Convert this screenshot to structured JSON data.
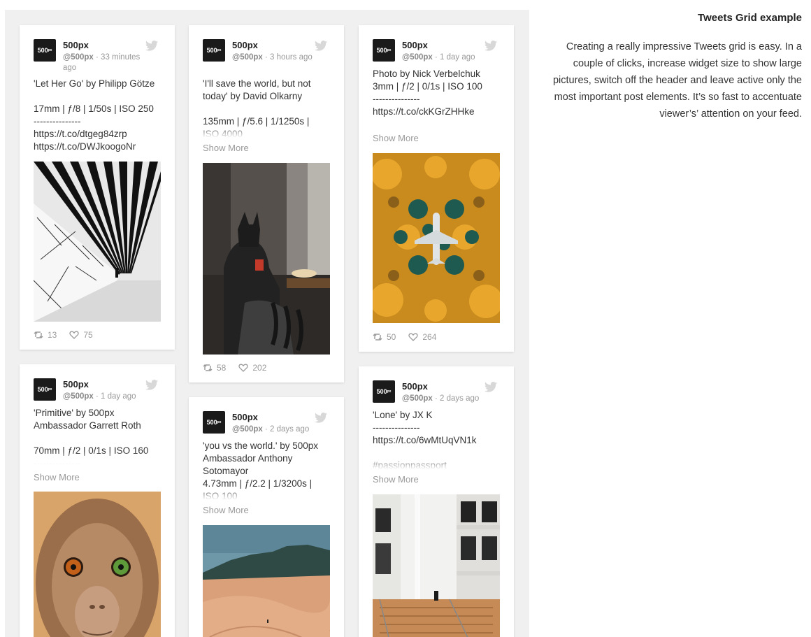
{
  "sidebar": {
    "title": "Tweets Grid example",
    "description": "Creating a really impressive Tweets grid is easy. In a couple of clicks, increase widget size to show large pictures, switch off the header and leave active only the most important post elements. It’s so fast to accentuate viewer’s’ attention on your feed."
  },
  "show_more_label": "Show More",
  "cards": [
    {
      "author": "500px",
      "handle": "@500px",
      "time": " · 33 minutes ago",
      "text": "'Let Her Go' by Philipp Götze\n\n17mm | ƒ/8 | 1/50s | ISO 250\n---------------\nhttps://t.co/dtgeg84zrp\nhttps://t.co/DWJkoogoNr",
      "retweets": "13",
      "likes": "75",
      "image": "corridor-photo"
    },
    {
      "author": "500px",
      "handle": "@500px",
      "time": " · 3 hours ago",
      "text": "'I'll save the world, but not today' by David Olkarny\n\n135mm | ƒ/5.6 | 1/1250s |\nISO 4000",
      "retweets": "58",
      "likes": "202",
      "image": "batman-photo"
    },
    {
      "author": "500px",
      "handle": "@500px",
      "time": " · 1 day ago",
      "text": "Photo by Nick Verbelchuk\n3mm | ƒ/2 | 0/1s | ISO 100\n---------------\nhttps://t.co/ckKGrZHHke",
      "retweets": "50",
      "likes": "264",
      "image": "forest-plane-photo"
    },
    {
      "author": "500px",
      "handle": "@500px",
      "time": " · 1 day ago",
      "text": "'Primitive' by 500px\nAmbassador Garrett Roth\n\n70mm | ƒ/2 | 0/1s | ISO 160\n---------------",
      "image": "monkey-photo"
    },
    {
      "author": "500px",
      "handle": "@500px",
      "time": " · 2 days ago",
      "text": "'you vs the world.' by 500px Ambassador Anthony Sotomayor\n4.73mm | ƒ/2.2 | 1/3200s |\nISO 100",
      "image": "desert-photo"
    },
    {
      "author": "500px",
      "handle": "@500px",
      "time": " · 2 days ago",
      "text": "'Lone' by JX K\n---------------\nhttps://t.co/6wMtUqVN1k\n\n#passionpassport",
      "image": "building-photo"
    }
  ],
  "colors": {
    "panel_bg": "#f0f0f0",
    "card_bg": "#ffffff",
    "muted_text": "#9a9a9a"
  }
}
